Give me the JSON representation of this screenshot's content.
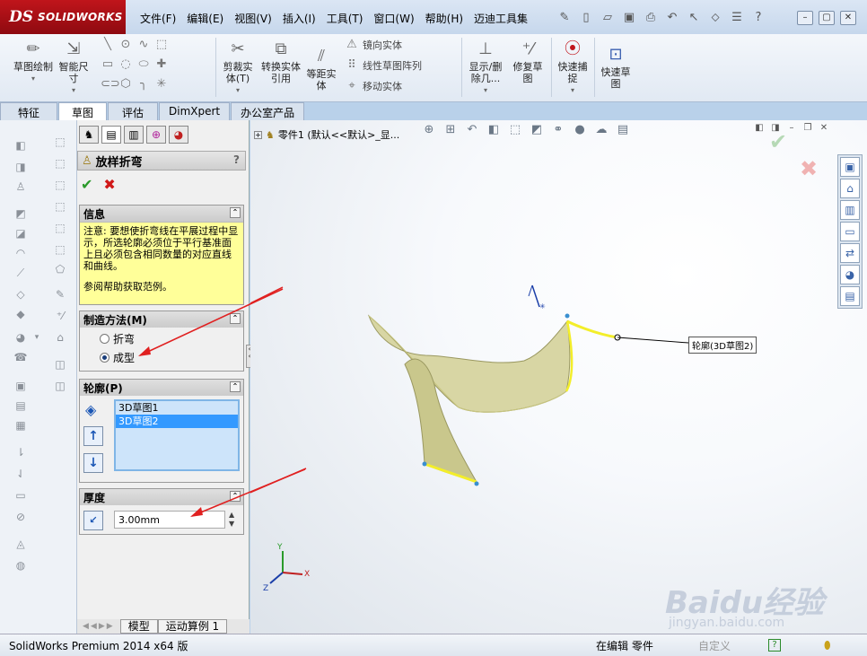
{
  "app": {
    "brand_prefix": "DS",
    "brand": "SOLIDWORKS"
  },
  "menu": [
    "文件(F)",
    "编辑(E)",
    "视图(V)",
    "插入(I)",
    "工具(T)",
    "窗口(W)",
    "帮助(H)",
    "迈迪工具集"
  ],
  "ribbon": {
    "sketch": "草图绘制",
    "smart_dim": "智能尺寸",
    "trim": "剪裁实体(T)",
    "convert": "转换实体引用",
    "offset": "等距实体",
    "mirror": "镜向实体",
    "linear_pattern": "线性草图阵列",
    "move": "移动实体",
    "show_delete": "显示/删除几...",
    "repair": "修复草图",
    "quick_snap": "快速捕捉",
    "quick_sketch": "快速草图"
  },
  "tabs": [
    "特征",
    "草图",
    "评估",
    "DimXpert",
    "办公室产品"
  ],
  "tree": {
    "part": "零件1  (默认<<默认>_显..."
  },
  "pm": {
    "title": "放样折弯",
    "help": "?",
    "info": {
      "header": "信息",
      "text": "注意: 要想使折弯线在平展过程中显示，所选轮廓必须位于平行基准面上且必须包含相同数量的对应直线和曲线。",
      "help_link": "参阅帮助获取范例。"
    },
    "method": {
      "header": "制造方法(M)",
      "opt1": "折弯",
      "opt2": "成型"
    },
    "profile": {
      "header": "轮廓(P)",
      "items": [
        "3D草图1",
        "3D草图2"
      ]
    },
    "thickness": {
      "header": "厚度",
      "value": "3.00mm"
    }
  },
  "bottom_tabs": [
    "模型",
    "运动算例 1"
  ],
  "viewport": {
    "callout": "轮廓(3D草图2)",
    "axis_x": "X",
    "axis_y": "Y",
    "axis_z": "Z"
  },
  "status": {
    "left": "SolidWorks Premium 2014 x64 版",
    "editing": "在编辑 零件",
    "custom": "自定义"
  },
  "watermark": {
    "main": "Baidu经验",
    "sub": "jingyan.baidu.com"
  },
  "colors": {
    "accent": "#c0151b",
    "selection": "#3399ff",
    "info_bg": "#ffff99",
    "annotation_arrow": "#e02020"
  }
}
